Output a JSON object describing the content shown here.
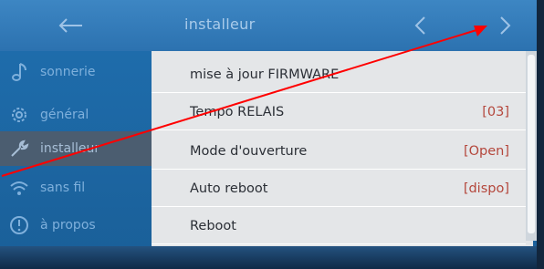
{
  "header": {
    "title": "installeur",
    "back_icon": "back-arrow-icon",
    "prev_icon": "chevron-left-icon",
    "next_icon": "chevron-right-icon"
  },
  "sidebar": {
    "items": [
      {
        "label": "sonnerie",
        "icon": "music-note-icon",
        "active": false
      },
      {
        "label": "général",
        "icon": "gear-icon",
        "active": false
      },
      {
        "label": "installeur",
        "icon": "wrench-icon",
        "active": true
      },
      {
        "label": "sans fil",
        "icon": "wifi-icon",
        "active": false
      },
      {
        "label": "à propos",
        "icon": "info-icon",
        "active": false
      }
    ]
  },
  "menu": {
    "rows": [
      {
        "label": "mise à jour FIRMWARE",
        "value": ""
      },
      {
        "label": "Tempo RELAIS",
        "value": "[03]"
      },
      {
        "label": "Mode d'ouverture",
        "value": "[Open]"
      },
      {
        "label": "Auto reboot",
        "value": "[dispo]"
      },
      {
        "label": "Reboot",
        "value": ""
      }
    ]
  },
  "colors": {
    "header": "#2c72b0",
    "sidebar": "#1e6cab",
    "active_item": "#4b5d70",
    "list_bg": "#e4e6e8",
    "value_text": "#b4473c",
    "annotation_arrow": "#ff0000"
  }
}
